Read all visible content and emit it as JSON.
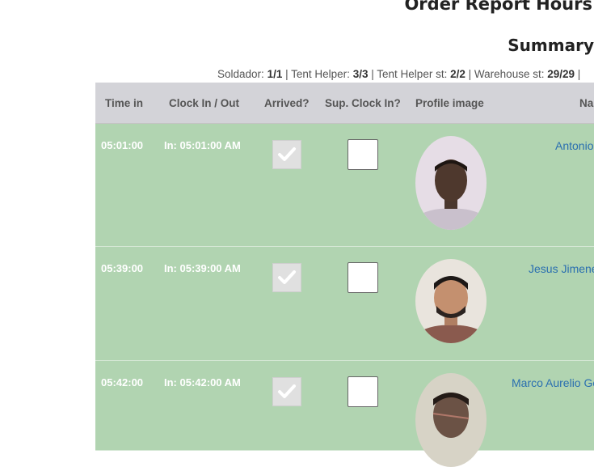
{
  "page": {
    "title": "Order Report Hours",
    "summary_heading": "Summary"
  },
  "summary_counts": [
    {
      "label": "Soldador:",
      "value": "1/1"
    },
    {
      "label": "Tent Helper:",
      "value": "3/3"
    },
    {
      "label": "Tent Helper st:",
      "value": "2/2"
    },
    {
      "label": "Warehouse st:",
      "value": "29/29"
    }
  ],
  "table": {
    "headers": {
      "time_in": "Time in",
      "clock": "Clock In / Out",
      "arrived": "Arrived?",
      "sup_clock": "Sup. Clock In?",
      "profile": "Profile image",
      "name": "Na"
    },
    "rows": [
      {
        "time_in": "05:01:00",
        "clock": "In: 05:01:00 AM",
        "arrived": true,
        "sup_clock_in": false,
        "name": "Antonio"
      },
      {
        "time_in": "05:39:00",
        "clock": "In: 05:39:00 AM",
        "arrived": true,
        "sup_clock_in": false,
        "name": "Jesus Jimene"
      },
      {
        "time_in": "05:42:00",
        "clock": "In: 05:42:00 AM",
        "arrived": true,
        "sup_clock_in": false,
        "name": "Marco Aurelio Go"
      }
    ]
  },
  "colors": {
    "row_bg": "#b1d4b1",
    "header_bg": "#d3d3d8",
    "link": "#2a6fb0"
  }
}
